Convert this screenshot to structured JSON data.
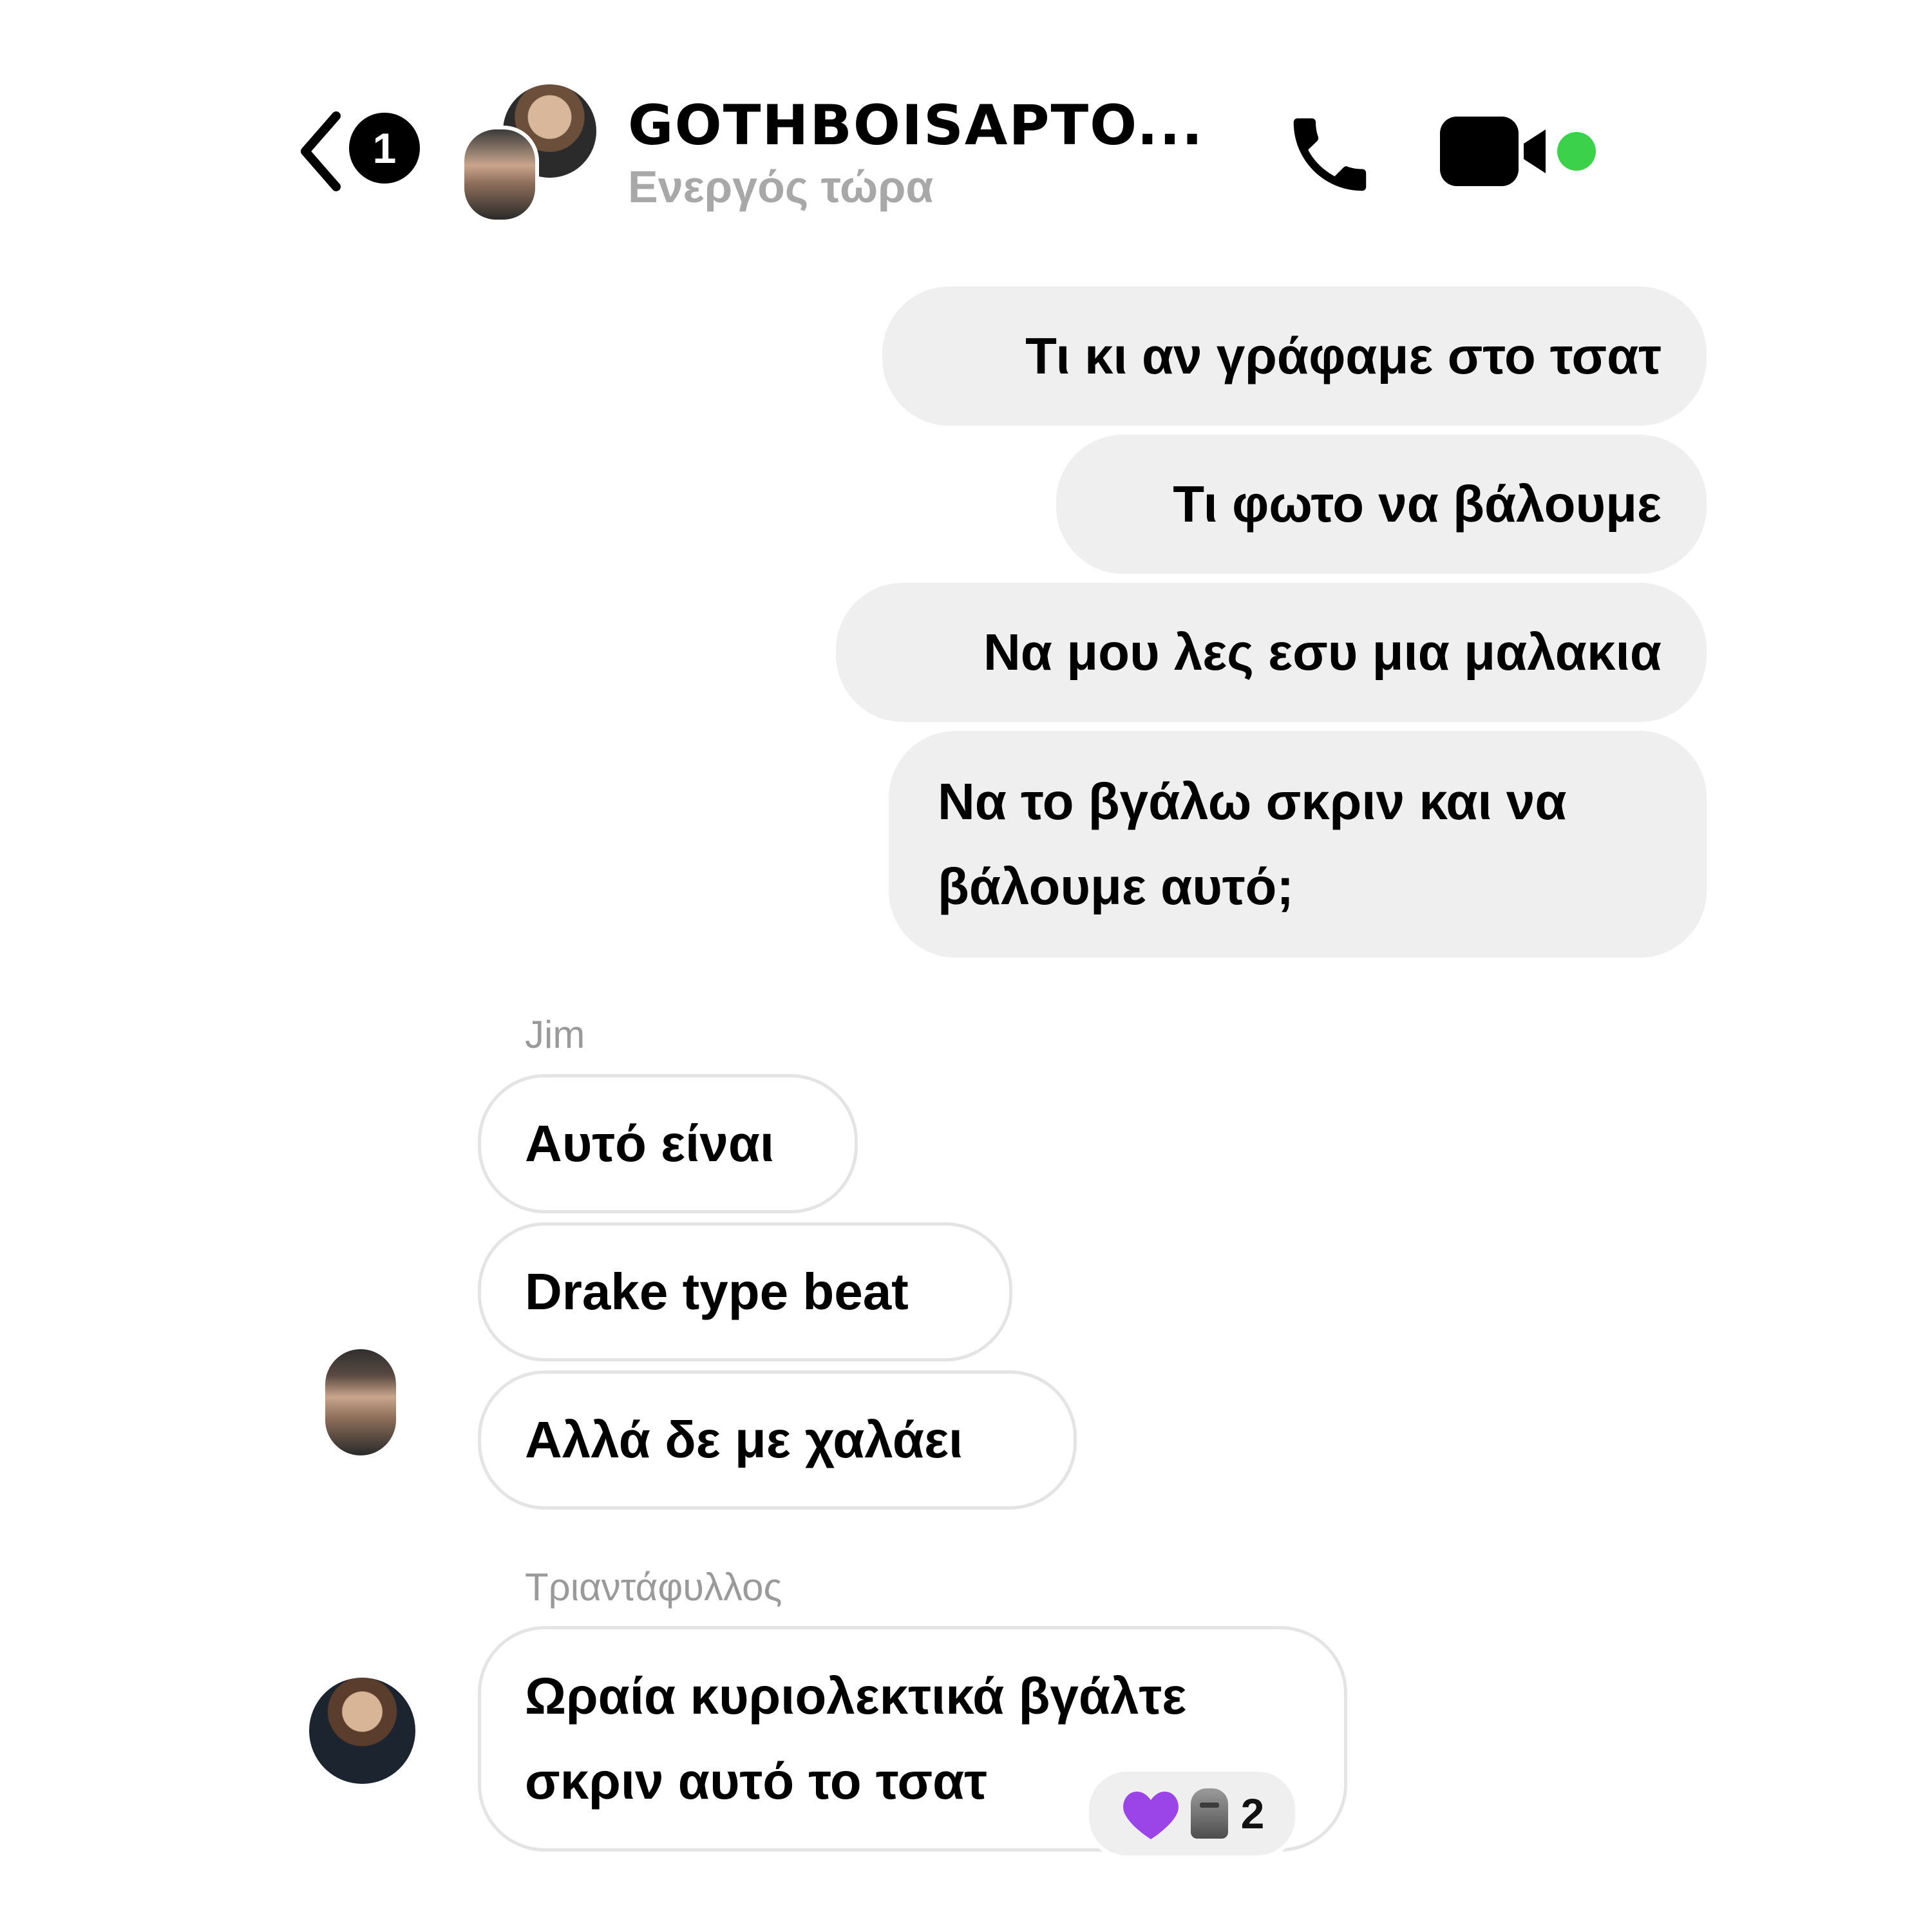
{
  "header": {
    "unread_count": "1",
    "title": "GOTHBOISAPTO...",
    "status": "Ενεργός τώρα",
    "icons": {
      "back": "chevron-left-icon",
      "call": "phone-icon",
      "video": "video-camera-icon"
    },
    "colors": {
      "online": "#3bd14a",
      "status_text": "#a8a8a8"
    }
  },
  "messages": {
    "outgoing": [
      {
        "text": "Τι κι αν γράφαμε στο τσατ"
      },
      {
        "text": "Τι φωτο να βάλουμε"
      },
      {
        "text": "Να μου λες εσυ μια μαλακια"
      },
      {
        "text": "Να το βγάλω σκριν και να βάλουμε αυτό;"
      }
    ],
    "groups": [
      {
        "sender": "Jim",
        "items": [
          {
            "text": "Αυτό είναι"
          },
          {
            "text": "Drake type beat"
          },
          {
            "text": "Αλλά δε με χαλάει"
          }
        ]
      },
      {
        "sender": "Τριαντάφυλλος",
        "items": [
          {
            "text": "Ωραία κυριολεκτικά βγάλτε σκριν αυτό το τσατ"
          }
        ],
        "reactions": {
          "emojis": [
            "purple-heart-icon",
            "moai-icon"
          ],
          "count": "2"
        }
      }
    ],
    "colors": {
      "outgoing_bubble": "#efefef",
      "incoming_border": "#e4e4e4",
      "sender_name": "#9a9a9a"
    }
  }
}
